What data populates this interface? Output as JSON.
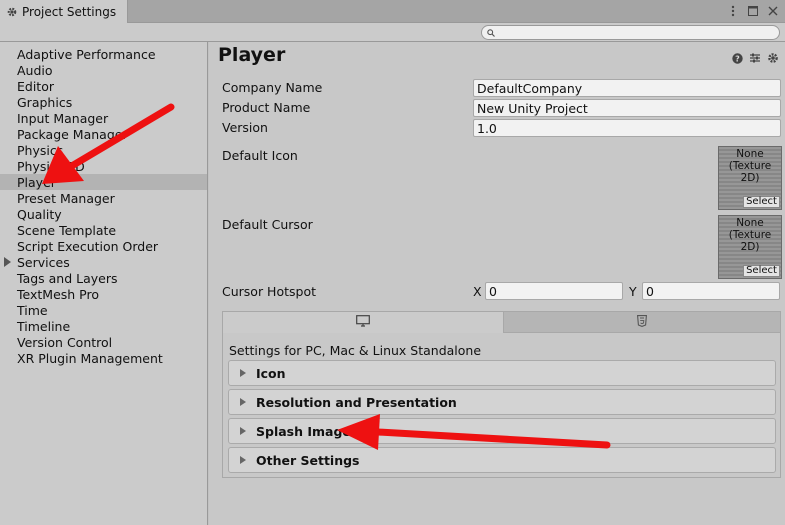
{
  "window": {
    "tab_title": "Project Settings",
    "search_placeholder": ""
  },
  "sidebar": {
    "items": [
      {
        "label": "Adaptive Performance",
        "name": "sidebar-item-adaptive-performance"
      },
      {
        "label": "Audio",
        "name": "sidebar-item-audio"
      },
      {
        "label": "Editor",
        "name": "sidebar-item-editor"
      },
      {
        "label": "Graphics",
        "name": "sidebar-item-graphics"
      },
      {
        "label": "Input Manager",
        "name": "sidebar-item-input-manager"
      },
      {
        "label": "Package Manager",
        "name": "sidebar-item-package-manager"
      },
      {
        "label": "Physics",
        "name": "sidebar-item-physics"
      },
      {
        "label": "Physics 2D",
        "name": "sidebar-item-physics-2d"
      },
      {
        "label": "Player",
        "name": "sidebar-item-player",
        "selected": true
      },
      {
        "label": "Preset Manager",
        "name": "sidebar-item-preset-manager"
      },
      {
        "label": "Quality",
        "name": "sidebar-item-quality"
      },
      {
        "label": "Scene Template",
        "name": "sidebar-item-scene-template"
      },
      {
        "label": "Script Execution Order",
        "name": "sidebar-item-script-execution-order"
      },
      {
        "label": "Services",
        "name": "sidebar-item-services",
        "expandable": true
      },
      {
        "label": "Tags and Layers",
        "name": "sidebar-item-tags-and-layers"
      },
      {
        "label": "TextMesh Pro",
        "name": "sidebar-item-textmesh-pro"
      },
      {
        "label": "Time",
        "name": "sidebar-item-time"
      },
      {
        "label": "Timeline",
        "name": "sidebar-item-timeline"
      },
      {
        "label": "Version Control",
        "name": "sidebar-item-version-control"
      },
      {
        "label": "XR Plugin Management",
        "name": "sidebar-item-xr-plugin-management"
      }
    ]
  },
  "main": {
    "title": "Player",
    "company_label": "Company Name",
    "company_value": "DefaultCompany",
    "product_label": "Product Name",
    "product_value": "New Unity Project",
    "version_label": "Version",
    "version_value": "1.0",
    "default_icon_label": "Default Icon",
    "default_cursor_label": "Default Cursor",
    "texture_none": "None",
    "texture_type": "(Texture 2D)",
    "texture_select": "Select",
    "cursor_hotspot_label": "Cursor Hotspot",
    "hotspot_x_label": "X",
    "hotspot_x_value": "0",
    "hotspot_y_label": "Y",
    "hotspot_y_value": "0"
  },
  "platform": {
    "settings_title": "Settings for PC, Mac & Linux Standalone",
    "sections": [
      "Icon",
      "Resolution and Presentation",
      "Splash Image",
      "Other Settings"
    ]
  },
  "colors": {
    "annotation_arrow": "#ee1111"
  }
}
